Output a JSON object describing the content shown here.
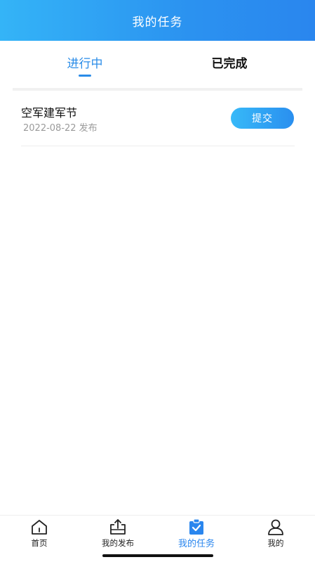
{
  "header": {
    "title": "我的任务"
  },
  "tabs": [
    {
      "label": "进行中",
      "active": true
    },
    {
      "label": "已完成",
      "active": false
    }
  ],
  "tasks": [
    {
      "title": "空军建军节",
      "date": "2022-08-22",
      "status": "发布",
      "action": "提交"
    }
  ],
  "bottom_nav": [
    {
      "label": "首页",
      "icon": "home-icon"
    },
    {
      "label": "我的发布",
      "icon": "upload-tray-icon"
    },
    {
      "label": "我的任务",
      "icon": "clipboard-check-icon",
      "active": true
    },
    {
      "label": "我的",
      "icon": "user-icon"
    }
  ],
  "colors": {
    "accent": "#2a86ee",
    "header_start": "#34b4f7",
    "header_end": "#2a86ee",
    "meta_text": "#9a9a9a"
  }
}
